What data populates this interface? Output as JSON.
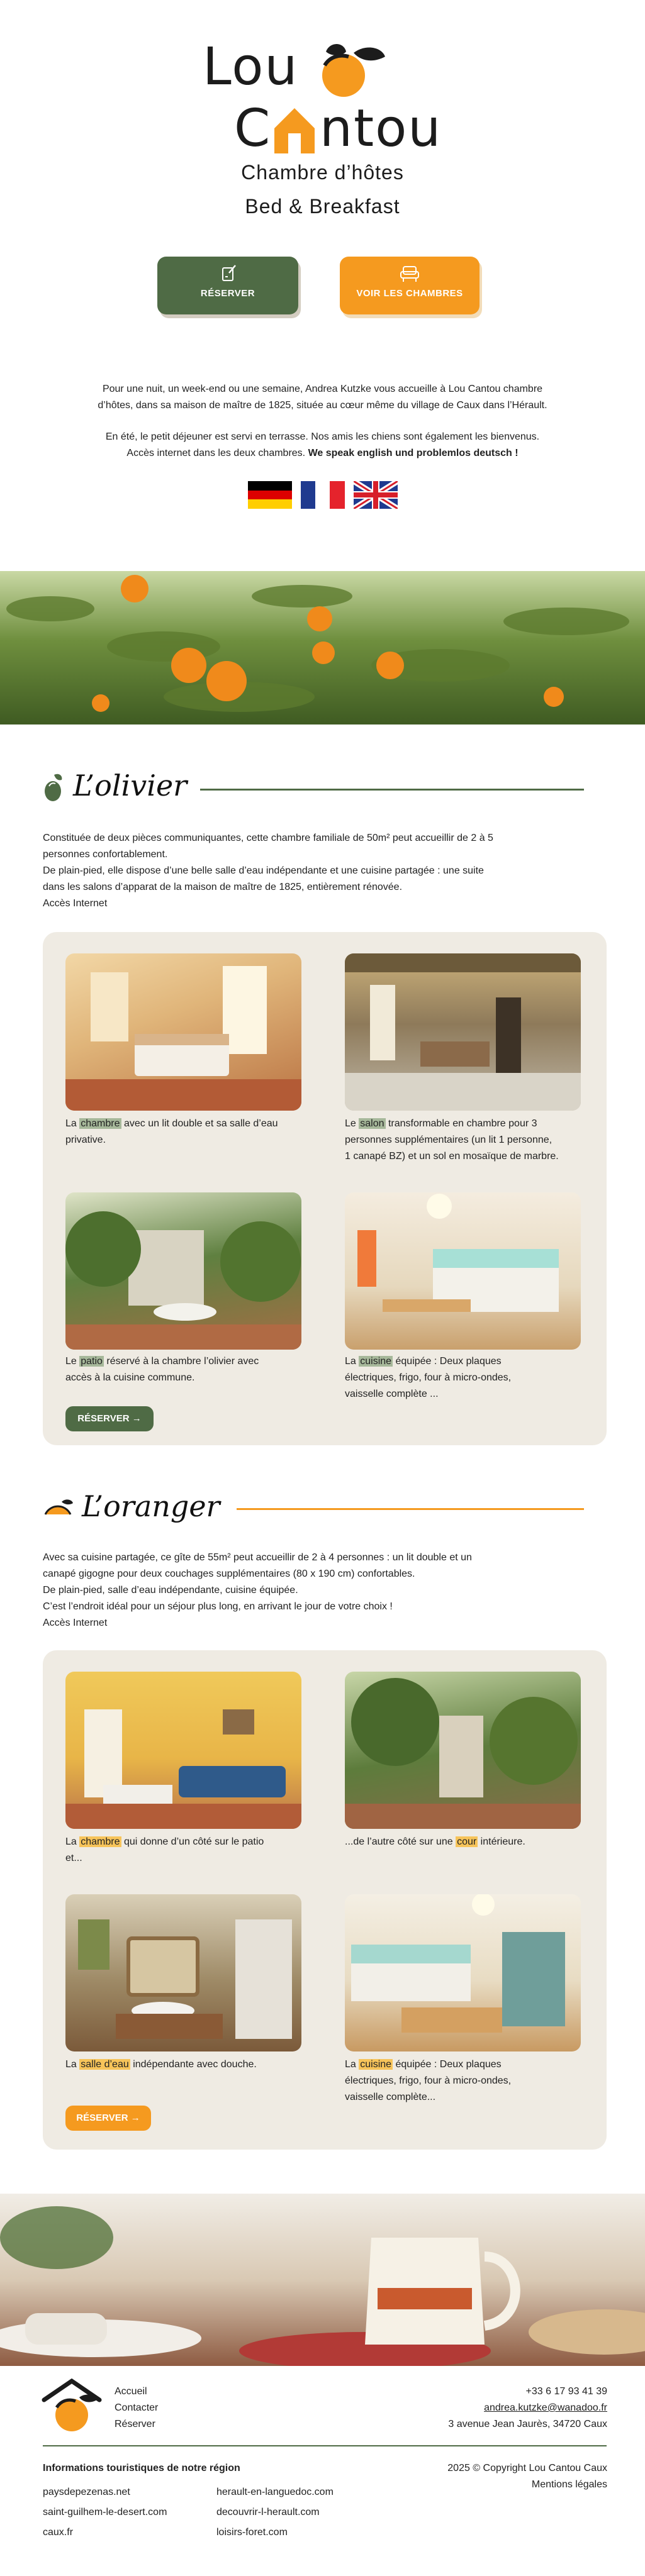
{
  "header": {
    "logo_line1": "Lou",
    "logo_line2_a": "C",
    "logo_line2_b": "ntou",
    "subtitle": "Chambre d’hôtes",
    "subtitle2": "Bed & Breakfast"
  },
  "actions": {
    "reserve_label": "RÉSERVER",
    "rooms_label": "VOIR LES CHAMBRES"
  },
  "intro": {
    "p1_a": "Pour une nuit, un week-end ou une semaine, Andrea Kutzke vous accueille à Lou Cantou chambre",
    "p1_b": "d’hôtes, dans sa maison de maître de 1825, située au cœur même du village de Caux dans l’Hérault.",
    "p2_a": "En été, le petit déjeuner est servi en terrasse. Nos amis les chiens sont également les bienvenus.",
    "p2_b": "Accès internet dans les deux chambres.",
    "p2_bold": "We speak english und problemlos deutsch !"
  },
  "flags": [
    "de-flag",
    "fr-flag",
    "uk-flag"
  ],
  "olivier": {
    "title": "L’olivier",
    "desc": [
      "Constituée de deux pièces communiquantes, cette chambre familiale de 50m² peut accueillir de 2 à 5",
      "personnes confortablement.",
      "De plain-pied, elle dispose d’une belle salle d’eau indépendante et une cuisine partagée : une suite",
      "dans les salons d’apparat de la maison de maître de 1825, entièrement rénovée.",
      "Accès Internet"
    ],
    "cards": [
      {
        "pre": "La ",
        "hl": "chambre",
        "post": " avec un lit double et sa salle d’eau",
        "line2": "privative."
      },
      {
        "pre": "Le ",
        "hl": "salon",
        "post": " transformable en chambre pour 3",
        "line2": "personnes supplémentaires (un lit 1 personne,",
        "line3": "1 canapé BZ) et un sol en mosaïque de marbre."
      },
      {
        "pre": "Le ",
        "hl": "patio",
        "post": " réservé à la chambre l’olivier avec",
        "line2": "accès à la cuisine commune."
      },
      {
        "pre": "La ",
        "hl": "cuisine",
        "post": " équipée : Deux plaques",
        "line2": "électriques, frigo, four à micro-ondes,",
        "line3": "vaisselle complète ..."
      }
    ],
    "button": "RÉSERVER →"
  },
  "oranger": {
    "title": "L’oranger",
    "desc": [
      "Avec sa cuisine partagée, ce gîte de 55m² peut accueillir de 2 à 4 personnes : un lit double et un",
      "canapé gigogne pour deux couchages supplémentaires (80 x 190 cm) confortables.",
      "De plain-pied, salle d’eau indépendante, cuisine équipée.",
      "C’est l’endroit idéal pour un séjour plus long, en arrivant le jour de votre choix !",
      "Accès Internet"
    ],
    "cards": [
      {
        "pre": "La ",
        "hl": "chambre",
        "post": " qui donne d’un côté sur le patio",
        "line2": "et..."
      },
      {
        "pre": "...de l’autre côté sur une ",
        "hl": "cour",
        "post": " intérieure."
      },
      {
        "pre": "La ",
        "hl": "salle d’eau",
        "post": " indépendante avec douche."
      },
      {
        "pre": "La ",
        "hl": "cuisine",
        "post": " équipée : Deux plaques",
        "line2": "électriques, frigo, four à micro-ondes,",
        "line3": "vaisselle complète..."
      }
    ],
    "button": "RÉSERVER →"
  },
  "footer": {
    "nav": [
      "Accueil",
      "Contacter",
      "Réserver"
    ],
    "phone": "+33 6 17 93 41 39",
    "email": "andrea.kutzke@wanadoo.fr",
    "address": "3 avenue Jean Jaurès, 34720 Caux",
    "links_title": "Informations touristiques de notre région",
    "links_col1": [
      "paysdepezenas.net",
      "saint-guilhem-le-desert.com",
      "caux.fr"
    ],
    "links_col2": [
      "herault-en-languedoc.com",
      "decouvrir-l-herault.com",
      "loisirs-foret.com"
    ],
    "copyright": "2025 © Copyright Lou Cantou Caux",
    "legal": "Mentions légales"
  },
  "colors": {
    "green": "#4f6b45",
    "orange": "#f59a1f",
    "beige": "#efebe3"
  }
}
